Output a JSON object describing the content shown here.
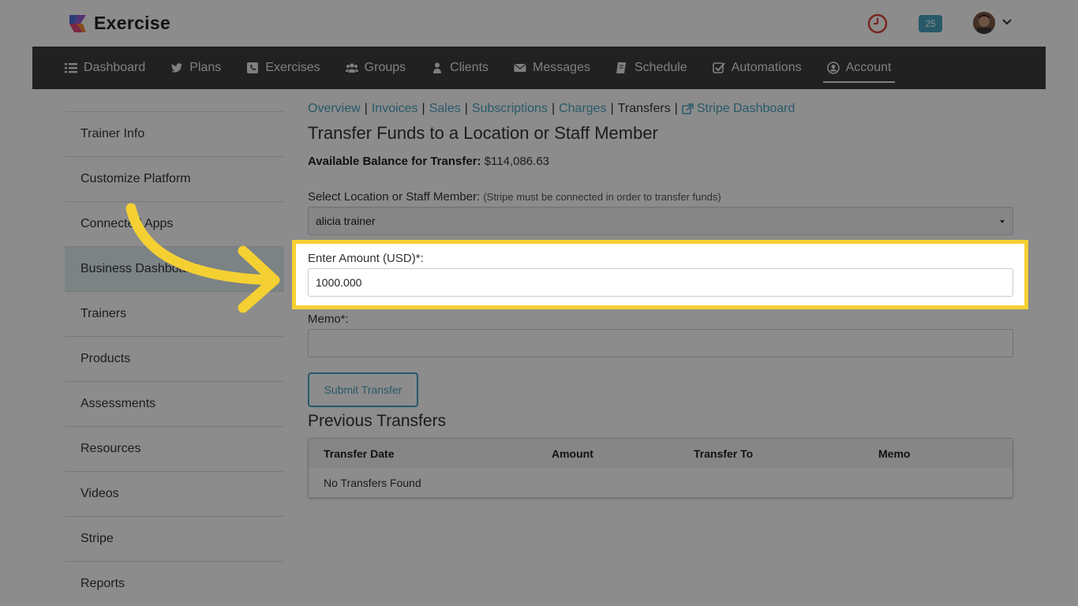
{
  "brand": {
    "name": "Exercise"
  },
  "header": {
    "notifications_count": "25"
  },
  "nav": {
    "items": [
      {
        "label": "Dashboard",
        "icon": "list-icon"
      },
      {
        "label": "Plans",
        "icon": "twitter-icon"
      },
      {
        "label": "Exercises",
        "icon": "phone-square-icon"
      },
      {
        "label": "Groups",
        "icon": "users-icon"
      },
      {
        "label": "Clients",
        "icon": "user-icon"
      },
      {
        "label": "Messages",
        "icon": "envelope-icon"
      },
      {
        "label": "Schedule",
        "icon": "book-icon"
      },
      {
        "label": "Automations",
        "icon": "check-square-icon"
      },
      {
        "label": "Account",
        "icon": "user-circle-icon",
        "active": true
      }
    ]
  },
  "sidebar": {
    "items": [
      {
        "label": "Trainer Info"
      },
      {
        "label": "Customize Platform"
      },
      {
        "label": "Connected Apps"
      },
      {
        "label": "Business Dashboard",
        "active": true
      },
      {
        "label": "Trainers"
      },
      {
        "label": "Products"
      },
      {
        "label": "Assessments"
      },
      {
        "label": "Resources"
      },
      {
        "label": "Videos"
      },
      {
        "label": "Stripe"
      },
      {
        "label": "Reports"
      }
    ]
  },
  "breadcrumbs": {
    "overview": "Overview",
    "invoices": "Invoices",
    "sales": "Sales",
    "subscriptions": "Subscriptions",
    "charges": "Charges",
    "transfers": "Transfers",
    "stripe_dashboard": "Stripe Dashboard",
    "separator": "|"
  },
  "page": {
    "title": "Transfer Funds to a Location or Staff Member",
    "balance_label": "Available Balance for Transfer:",
    "balance_value": "$114,086.63"
  },
  "form": {
    "recipient_label": "Select Location or Staff Member:",
    "recipient_hint": "(Stripe must be connected in order to transfer funds)",
    "recipient_value": "alicia trainer",
    "amount_label": "Enter Amount (USD)*:",
    "amount_value": "1000.000",
    "memo_label": "Memo*:",
    "memo_value": "",
    "submit_label": "Submit Transfer"
  },
  "transfers": {
    "title": "Previous Transfers",
    "columns": [
      "Transfer Date",
      "Amount",
      "Transfer To",
      "Memo"
    ],
    "empty_text": "No Transfers Found"
  },
  "colors": {
    "accent": "#4aa3bf",
    "nav_bg": "#3c3c3c",
    "highlight": "#f5d033",
    "sidebar_active": "#e1eef2"
  }
}
